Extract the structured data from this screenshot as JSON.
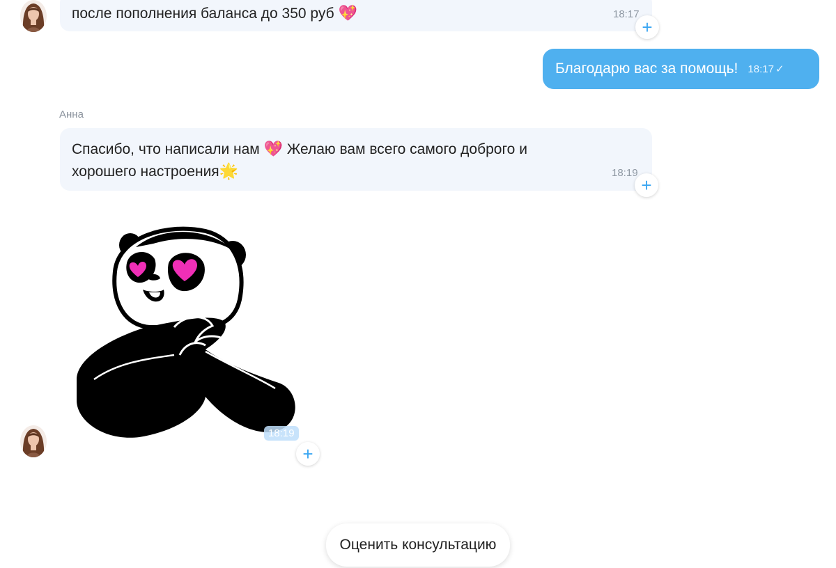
{
  "messages": [
    {
      "text": "после пополнения баланса до 350 руб",
      "emoji": "💖",
      "time": "18:17"
    },
    {
      "text": "Благодарю вас за помощь!",
      "time": "18:17",
      "check": "✓"
    },
    {
      "sender": "Анна",
      "line1": "Спасибо, что написали нам",
      "emoji1": "💖",
      "line1b": "Желаю вам всего самого доброго и",
      "line2": "хорошего настроения",
      "emoji2": "🌟",
      "time": "18:19"
    },
    {
      "sticker": "panda-hearts-sticker",
      "time": "18:19"
    }
  ],
  "plus_label": "+",
  "rate_button": "Оценить консультацию",
  "colors": {
    "incoming_bubble": "#f2f6fc",
    "outgoing_bubble": "#4fb0ef",
    "accent": "#3aa6f2"
  }
}
